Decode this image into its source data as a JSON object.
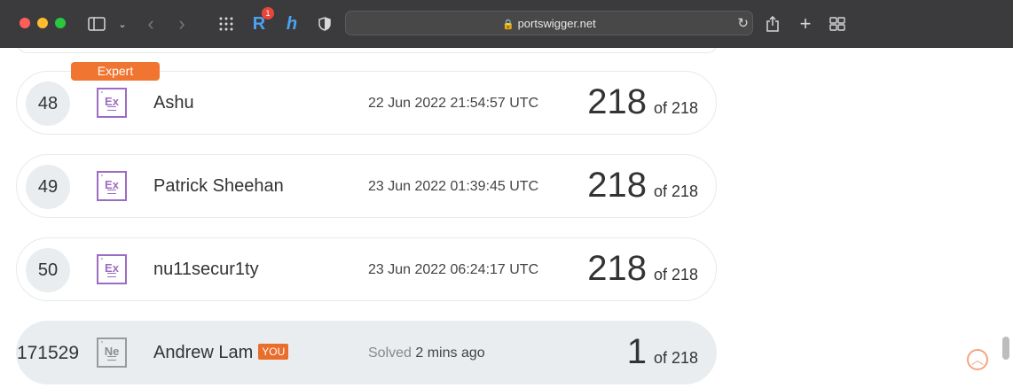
{
  "browser": {
    "url": "portswigger.net",
    "extension_badge": "1"
  },
  "expert_tag": "Expert",
  "rows": [
    {
      "rank": "48",
      "level_symbol": "Ex",
      "name": "Ashu",
      "date": "22 Jun 2022 21:54:57 UTC",
      "score": "218",
      "total": "of 218"
    },
    {
      "rank": "49",
      "level_symbol": "Ex",
      "name": "Patrick Sheehan",
      "date": "23 Jun 2022 01:39:45 UTC",
      "score": "218",
      "total": "of 218"
    },
    {
      "rank": "50",
      "level_symbol": "Ex",
      "name": "nu11secur1ty",
      "date": "23 Jun 2022 06:24:17 UTC",
      "score": "218",
      "total": "of 218"
    }
  ],
  "current_user": {
    "rank": "171529",
    "level_symbol": "Ne",
    "name": "Andrew Lam",
    "you_badge": "YOU",
    "solved_label": "Solved",
    "solved_time": "2 mins ago",
    "score": "1",
    "total": "of 218"
  },
  "icons": [
    "sidebar-icon",
    "back-icon",
    "forward-icon",
    "grid-icon",
    "reader-icon",
    "shield-icon",
    "lock-icon",
    "reload-icon",
    "share-icon",
    "new-tab-icon",
    "tabs-overview-icon",
    "scroll-to-top-icon"
  ],
  "colors": {
    "accent": "#f07531",
    "expert": "#9b6cc1",
    "row_highlight": "#e9edf0"
  }
}
